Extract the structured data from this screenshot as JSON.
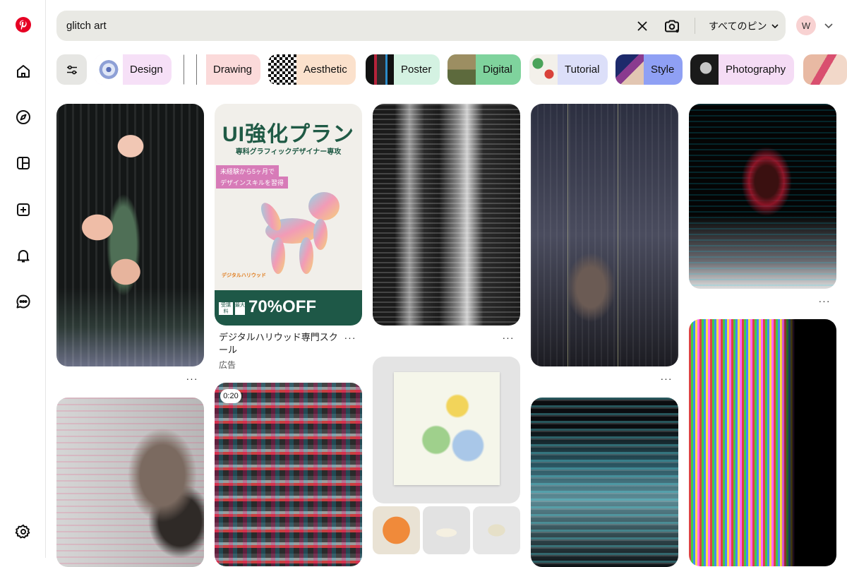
{
  "search": {
    "query": "glitch art",
    "placeholder": "",
    "filter_label": "すべてのピン"
  },
  "account": {
    "initial": "W"
  },
  "chips": [
    {
      "label": "Design",
      "bg": "#f6e0f7"
    },
    {
      "label": "Drawing",
      "bg": "#fbdada"
    },
    {
      "label": "Aesthetic",
      "bg": "#fbe1cc"
    },
    {
      "label": "Poster",
      "bg": "#d4f2e2"
    },
    {
      "label": "Digital",
      "bg": "#7fd39d"
    },
    {
      "label": "Tutorial",
      "bg": "#dcdff9"
    },
    {
      "label": "Style",
      "bg": "#8fa0f4"
    },
    {
      "label": "Photography",
      "bg": "#f5dcf5"
    }
  ],
  "ad": {
    "headline": "UI強化プラン",
    "subhead": "専科グラフィックデザイナー専攻",
    "tag1": "未経験から5ヶ月で",
    "tag2": "デザインスキルを習得",
    "brand": "デジタルハリウッド",
    "discount": "70%OFF",
    "discount_prefix": "最大",
    "prefix": "受講料",
    "title": "デジタルハリウッド専門スクール",
    "sub": "広告"
  },
  "video_badge": "0:20",
  "more_label": "···",
  "colors": {
    "accent": "#e60023",
    "search_bg": "#e9e9e4"
  }
}
